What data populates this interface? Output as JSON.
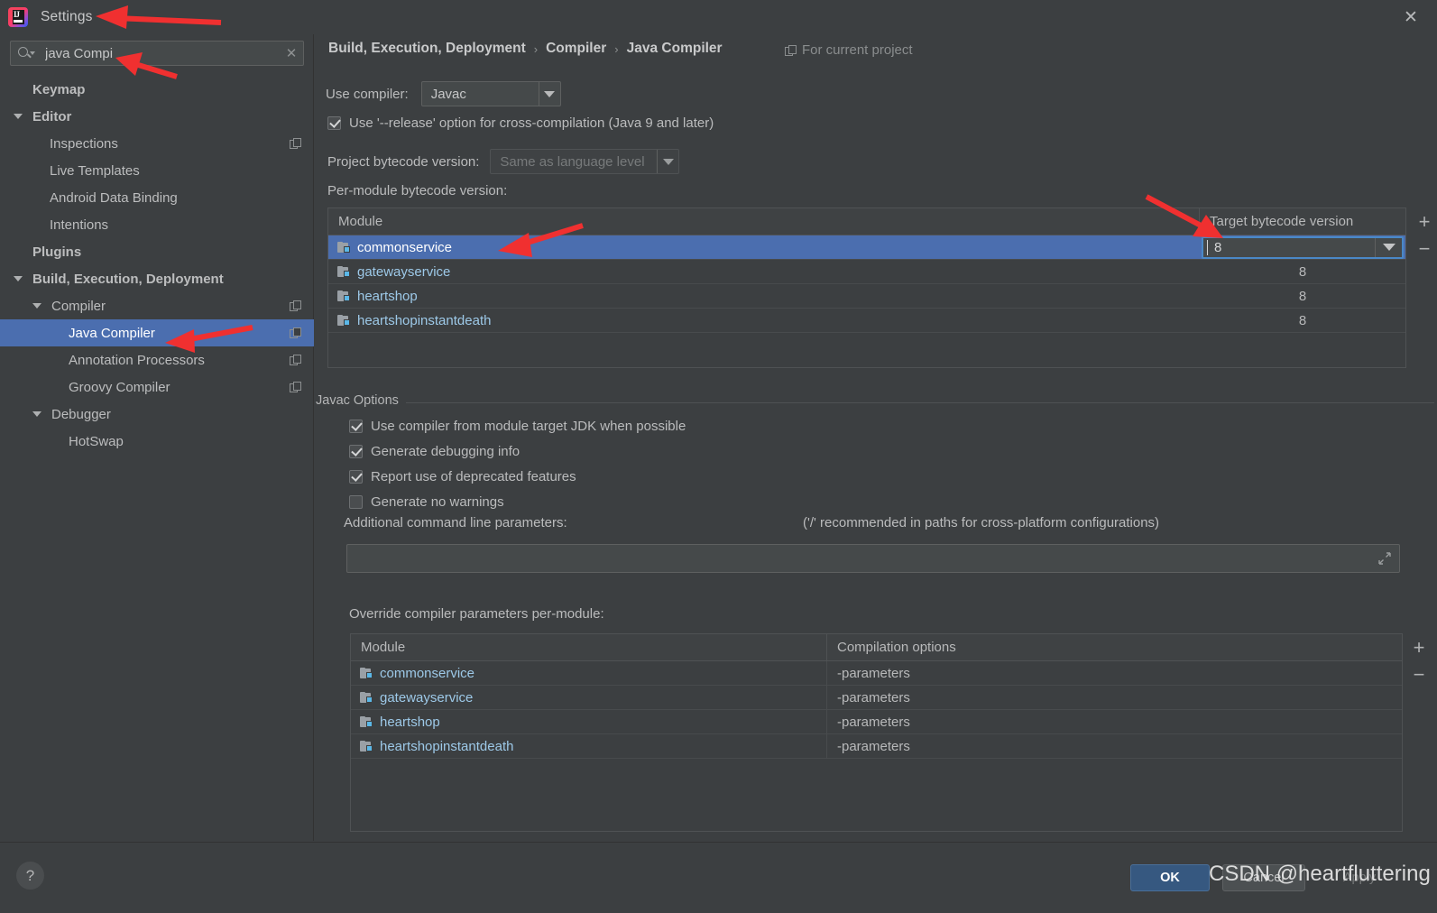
{
  "window": {
    "title": "Settings",
    "close_label": "✕",
    "logo_text": "IJ"
  },
  "search": {
    "value": "java Compi",
    "placeholder": "",
    "clear_label": "✕",
    "icon": "search-icon"
  },
  "sidebar": {
    "items": [
      {
        "label": "Keymap",
        "indent": 36,
        "bold": true,
        "arrow": false,
        "copy": false,
        "selected": false
      },
      {
        "label": "Editor",
        "indent": 36,
        "bold": true,
        "arrow": true,
        "copy": false,
        "selected": false
      },
      {
        "label": "Inspections",
        "indent": 55,
        "bold": false,
        "arrow": false,
        "copy": true,
        "selected": false
      },
      {
        "label": "Live Templates",
        "indent": 55,
        "bold": false,
        "arrow": false,
        "copy": false,
        "selected": false
      },
      {
        "label": "Android Data Binding",
        "indent": 55,
        "bold": false,
        "arrow": false,
        "copy": false,
        "selected": false
      },
      {
        "label": "Intentions",
        "indent": 55,
        "bold": false,
        "arrow": false,
        "copy": false,
        "selected": false
      },
      {
        "label": "Plugins",
        "indent": 36,
        "bold": true,
        "arrow": false,
        "copy": false,
        "selected": false
      },
      {
        "label": "Build, Execution, Deployment",
        "indent": 36,
        "bold": true,
        "arrow": true,
        "copy": false,
        "selected": false
      },
      {
        "label": "Compiler",
        "indent": 57,
        "bold": false,
        "arrow": true,
        "copy": true,
        "selected": false
      },
      {
        "label": "Java Compiler",
        "indent": 76,
        "bold": false,
        "arrow": false,
        "copy": true,
        "selected": true
      },
      {
        "label": "Annotation Processors",
        "indent": 76,
        "bold": false,
        "arrow": false,
        "copy": true,
        "selected": false
      },
      {
        "label": "Groovy Compiler",
        "indent": 76,
        "bold": false,
        "arrow": false,
        "copy": true,
        "selected": false
      },
      {
        "label": "Debugger",
        "indent": 57,
        "bold": false,
        "arrow": true,
        "copy": false,
        "selected": false
      },
      {
        "label": "HotSwap",
        "indent": 76,
        "bold": false,
        "arrow": false,
        "copy": false,
        "selected": false
      }
    ]
  },
  "main": {
    "breadcrumb": {
      "part1": "Build, Execution, Deployment",
      "sep1": "›",
      "part2": "Compiler",
      "sep2": "›",
      "part3": "Java Compiler"
    },
    "for_current_project": "For current project",
    "use_compiler_label": "Use compiler:",
    "use_compiler_value": "Javac",
    "release_option_label": "Use '--release' option for cross-compilation (Java 9 and later)",
    "release_option_checked": true,
    "project_bytecode_label": "Project bytecode version:",
    "project_bytecode_value": "Same as language level",
    "per_module_label": "Per-module bytecode version:",
    "bytecode_table": {
      "columns": [
        "Module",
        "Target bytecode version"
      ],
      "rows": [
        {
          "module": "commonservice",
          "version": "8",
          "selected": true,
          "editing": true
        },
        {
          "module": "gatewayservice",
          "version": "8",
          "selected": false,
          "editing": false
        },
        {
          "module": "heartshop",
          "version": "8",
          "selected": false,
          "editing": false
        },
        {
          "module": "heartshopinstantdeath",
          "version": "8",
          "selected": false,
          "editing": false
        }
      ],
      "add_label": "+",
      "remove_label": "−"
    },
    "javac_options_title": "Javac Options",
    "javac_checkboxes": [
      {
        "label": "Use compiler from module target JDK when possible",
        "checked": true
      },
      {
        "label": "Generate debugging info",
        "checked": true
      },
      {
        "label": "Report use of deprecated features",
        "checked": true
      },
      {
        "label": "Generate no warnings",
        "checked": false
      }
    ],
    "additional_params_label": "Additional command line parameters:",
    "additional_params_hint": "('/' recommended in paths for cross-platform configurations)",
    "additional_params_value": "",
    "override_label": "Override compiler parameters per-module:",
    "override_table": {
      "columns": [
        "Module",
        "Compilation options"
      ],
      "rows": [
        {
          "module": "commonservice",
          "options": "-parameters"
        },
        {
          "module": "gatewayservice",
          "options": "-parameters"
        },
        {
          "module": "heartshop",
          "options": "-parameters"
        },
        {
          "module": "heartshopinstantdeath",
          "options": "-parameters"
        }
      ],
      "add_label": "+",
      "remove_label": "−"
    }
  },
  "footer": {
    "help_label": "?",
    "ok_label": "OK",
    "cancel_label": "Cancel",
    "apply_label": "Apply"
  },
  "watermark": "CSDN @heartfluttering",
  "colors": {
    "background": "#3c3f41",
    "selection": "#4b6eaf",
    "accent_button": "#365880",
    "link_text": "#9dc9e8",
    "annotation": "#f03030"
  }
}
